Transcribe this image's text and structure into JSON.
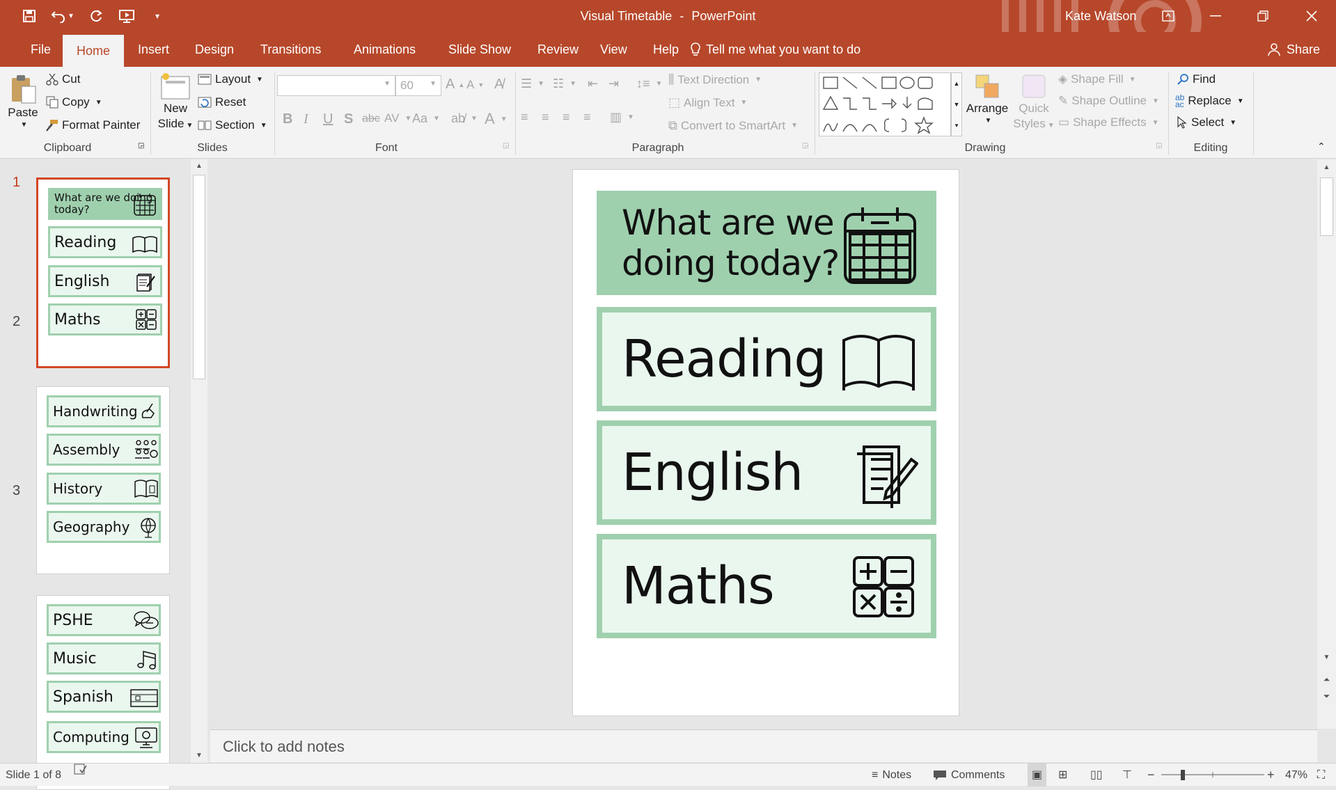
{
  "app": {
    "document_title": "Visual Timetable",
    "separator": "-",
    "app_name": "PowerPoint",
    "user_name": "Kate Watson"
  },
  "colors": {
    "accent": "#b7472a",
    "card_fill": "#eaf7ee",
    "card_border": "#9fd0ae",
    "selection": "#d24726"
  },
  "tabs": [
    {
      "label": "File"
    },
    {
      "label": "Home"
    },
    {
      "label": "Insert"
    },
    {
      "label": "Design"
    },
    {
      "label": "Transitions"
    },
    {
      "label": "Animations"
    },
    {
      "label": "Slide Show"
    },
    {
      "label": "Review"
    },
    {
      "label": "View"
    },
    {
      "label": "Help"
    }
  ],
  "tell_me": "Tell me what you want to do",
  "share": "Share",
  "ribbon": {
    "clipboard": {
      "label": "Clipboard",
      "paste": "Paste",
      "cut": "Cut",
      "copy": "Copy",
      "format_painter": "Format Painter"
    },
    "slides": {
      "label": "Slides",
      "new_slide_1": "New",
      "new_slide_2": "Slide",
      "layout": "Layout",
      "reset": "Reset",
      "section": "Section"
    },
    "font": {
      "label": "Font",
      "font_name": "",
      "font_size": "60"
    },
    "paragraph": {
      "label": "Paragraph",
      "text_direction": "Text Direction",
      "align_text": "Align Text",
      "convert_smartart": "Convert to SmartArt"
    },
    "drawing": {
      "label": "Drawing",
      "arrange": "Arrange",
      "quick_styles_1": "Quick",
      "quick_styles_2": "Styles",
      "shape_fill": "Shape Fill",
      "shape_outline": "Shape Outline",
      "shape_effects": "Shape Effects"
    },
    "editing": {
      "label": "Editing",
      "find": "Find",
      "replace": "Replace",
      "select": "Select"
    }
  },
  "thumbnails": [
    {
      "number": "1",
      "items": [
        {
          "text": "What are we doing today?",
          "icon": "calendar-icon"
        },
        {
          "text": "Reading",
          "icon": "book-icon"
        },
        {
          "text": "English",
          "icon": "document-pencil-icon"
        },
        {
          "text": "Maths",
          "icon": "calculator-icon"
        }
      ]
    },
    {
      "number": "2",
      "items": [
        {
          "text": "Handwriting",
          "icon": "hand-writing-icon"
        },
        {
          "text": "Assembly",
          "icon": "people-group-icon"
        },
        {
          "text": "History",
          "icon": "history-book-icon"
        },
        {
          "text": "Geography",
          "icon": "globe-icon"
        }
      ]
    },
    {
      "number": "3",
      "items": [
        {
          "text": "PSHE",
          "icon": "speech-bubbles-icon"
        },
        {
          "text": "Music",
          "icon": "music-notes-icon"
        },
        {
          "text": "Spanish",
          "icon": "flag-icon"
        },
        {
          "text": "Computing",
          "icon": "computer-icon"
        }
      ]
    }
  ],
  "slide": {
    "cards": [
      {
        "line1": "What are we",
        "line2": "doing today?",
        "icon": "calendar-icon"
      },
      {
        "text": "Reading",
        "icon": "book-icon"
      },
      {
        "text": "English",
        "icon": "document-pencil-icon"
      },
      {
        "text": "Maths",
        "icon": "calculator-icon"
      }
    ]
  },
  "notes_placeholder": "Click to add notes",
  "status": {
    "slide_info": "Slide 1 of 8",
    "notes": "Notes",
    "comments": "Comments",
    "zoom_minus": "−",
    "zoom_plus": "+",
    "zoom": "47%"
  }
}
